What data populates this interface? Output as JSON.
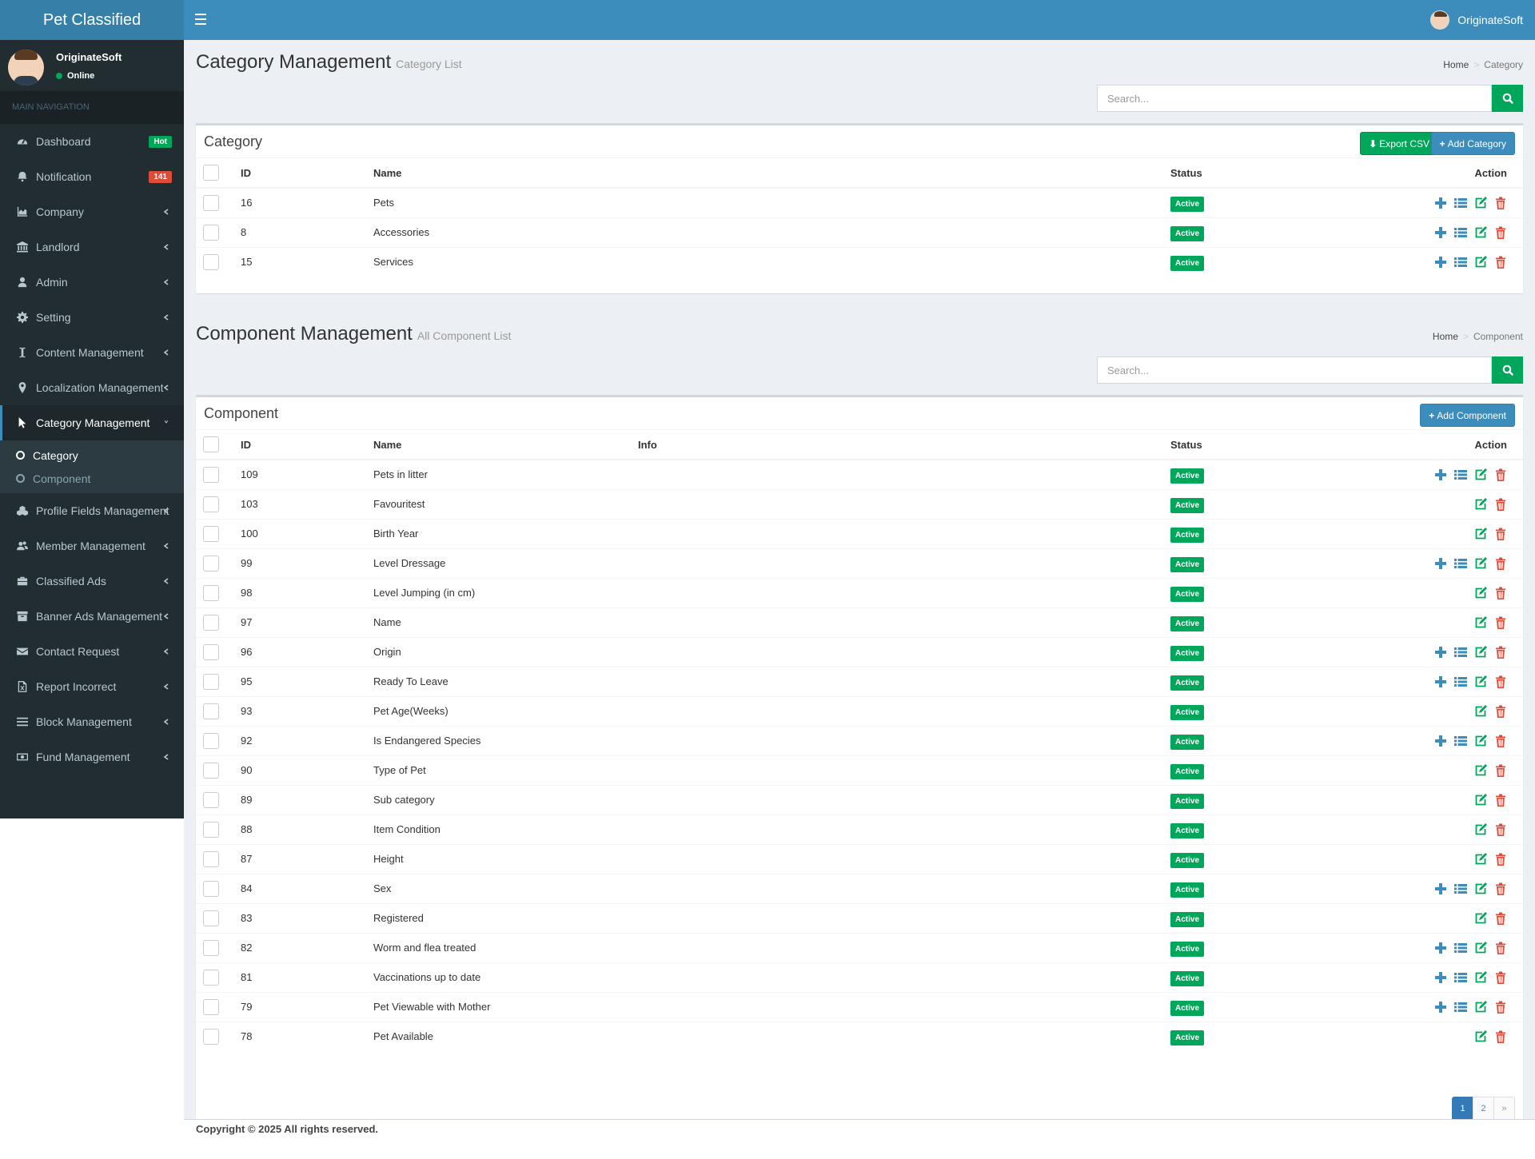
{
  "app": {
    "title": "Pet Classified",
    "username": "OriginateSoft"
  },
  "sidebar": {
    "user": {
      "name": "OriginateSoft",
      "status": "Online"
    },
    "nav_header": "MAIN NAVIGATION",
    "items": [
      {
        "label": "Dashboard",
        "icon": "dashboard-icon",
        "badge": "Hot"
      },
      {
        "label": "Notification",
        "icon": "bell-icon",
        "badge": "141"
      },
      {
        "label": "Company",
        "icon": "area-chart-icon"
      },
      {
        "label": "Landlord",
        "icon": "bank-icon"
      },
      {
        "label": "Admin",
        "icon": "user-icon"
      },
      {
        "label": "Setting",
        "icon": "gear-icon"
      },
      {
        "label": "Content Management",
        "icon": "text-cursor-icon"
      },
      {
        "label": "Localization Management",
        "icon": "map-marker-icon"
      },
      {
        "label": "Category Management",
        "icon": "mouse-pointer-icon",
        "active": true
      },
      {
        "label": "Profile Fields Management",
        "icon": "cubes-icon"
      },
      {
        "label": "Member Management",
        "icon": "users-icon"
      },
      {
        "label": "Classified Ads",
        "icon": "briefcase-icon"
      },
      {
        "label": "Banner Ads Management",
        "icon": "archive-icon"
      },
      {
        "label": "Contact Request",
        "icon": "envelope-icon"
      },
      {
        "label": "Report Incorrect",
        "icon": "file-excel-icon"
      },
      {
        "label": "Block Management",
        "icon": "bars-icon"
      },
      {
        "label": "Fund Management",
        "icon": "money-icon"
      }
    ],
    "submenu": [
      {
        "label": "Category",
        "active": true
      },
      {
        "label": "Component",
        "active": false
      }
    ]
  },
  "category_section": {
    "title": "Category Management",
    "subtitle": "Category List",
    "breadcrumb": [
      "Home",
      "Category"
    ],
    "search_placeholder": "Search...",
    "box_title": "Category",
    "export_label": "Export CSV",
    "add_label": "Add Category",
    "columns": [
      "ID",
      "Name",
      "Status",
      "Action"
    ],
    "rows": [
      {
        "id": "16",
        "name": "Pets",
        "status": "Active"
      },
      {
        "id": "8",
        "name": "Accessories",
        "status": "Active"
      },
      {
        "id": "15",
        "name": "Services",
        "status": "Active"
      }
    ]
  },
  "component_section": {
    "title": "Component Management",
    "subtitle": "All Component List",
    "breadcrumb": [
      "Home",
      "Component"
    ],
    "search_placeholder": "Search...",
    "box_title": "Component",
    "add_label": "Add Component",
    "columns": [
      "ID",
      "Name",
      "Info",
      "Status",
      "Action"
    ],
    "rows": [
      {
        "id": "109",
        "name": "Pets in litter",
        "status": "Active",
        "full": true
      },
      {
        "id": "103",
        "name": "Favouritest",
        "status": "Active",
        "full": false
      },
      {
        "id": "100",
        "name": "Birth Year",
        "status": "Active",
        "full": false
      },
      {
        "id": "99",
        "name": "Level Dressage",
        "status": "Active",
        "full": true
      },
      {
        "id": "98",
        "name": "Level Jumping (in cm)",
        "status": "Active",
        "full": false
      },
      {
        "id": "97",
        "name": "Name",
        "status": "Active",
        "full": false
      },
      {
        "id": "96",
        "name": "Origin",
        "status": "Active",
        "full": true
      },
      {
        "id": "95",
        "name": "Ready To Leave",
        "status": "Active",
        "full": true
      },
      {
        "id": "93",
        "name": "Pet Age(Weeks)",
        "status": "Active",
        "full": false
      },
      {
        "id": "92",
        "name": "Is Endangered Species",
        "status": "Active",
        "full": true
      },
      {
        "id": "90",
        "name": "Type of Pet",
        "status": "Active",
        "full": false
      },
      {
        "id": "89",
        "name": "Sub category",
        "status": "Active",
        "full": false
      },
      {
        "id": "88",
        "name": "Item Condition",
        "status": "Active",
        "full": false
      },
      {
        "id": "87",
        "name": "Height",
        "status": "Active",
        "full": false
      },
      {
        "id": "84",
        "name": "Sex",
        "status": "Active",
        "full": true
      },
      {
        "id": "83",
        "name": "Registered",
        "status": "Active",
        "full": false
      },
      {
        "id": "82",
        "name": "Worm and flea treated",
        "status": "Active",
        "full": true
      },
      {
        "id": "81",
        "name": "Vaccinations up to date",
        "status": "Active",
        "full": true
      },
      {
        "id": "79",
        "name": "Pet Viewable with Mother",
        "status": "Active",
        "full": true
      },
      {
        "id": "78",
        "name": "Pet Available",
        "status": "Active",
        "full": false
      }
    ],
    "pagination": [
      "1",
      "2",
      "»"
    ]
  },
  "footer": {
    "text": "Copyright © 2025 All rights reserved."
  },
  "colors": {
    "header": "#3c8dbc",
    "sidebar": "#222d32",
    "success": "#00a65a",
    "danger": "#dd4b39"
  }
}
